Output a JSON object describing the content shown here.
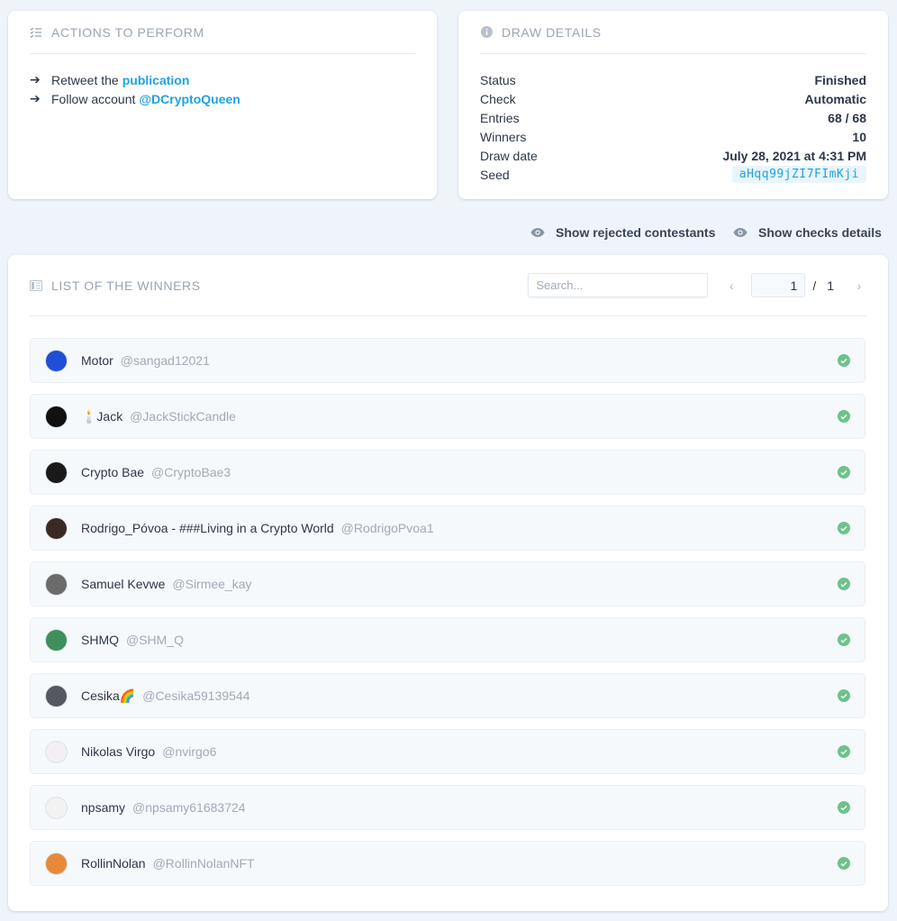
{
  "actions": {
    "title": "ACTIONS TO PERFORM",
    "items": [
      {
        "prefix": "Retweet the",
        "link": "publication"
      },
      {
        "prefix": "Follow account",
        "link": "@DCryptoQueen"
      }
    ]
  },
  "details": {
    "title": "DRAW DETAILS",
    "rows": [
      {
        "label": "Status",
        "value": "Finished"
      },
      {
        "label": "Check",
        "value": "Automatic"
      },
      {
        "label": "Entries",
        "value": "68 / 68"
      },
      {
        "label": "Winners",
        "value": "10"
      },
      {
        "label": "Draw date",
        "value": "July 28, 2021 at 4:31 PM"
      },
      {
        "label": "Seed",
        "value": "aHqq99jZI7FImKji"
      }
    ]
  },
  "toggles": {
    "rejected": "Show rejected contestants",
    "checks": "Show checks details"
  },
  "winners": {
    "title": "LIST OF THE WINNERS",
    "search_placeholder": "Search...",
    "page_current": "1",
    "page_separator": "/",
    "page_total": "1",
    "items": [
      {
        "name": "Motor",
        "handle": "@sangad12021",
        "avatar_color": "#1e4fd6"
      },
      {
        "name": "🕯️Jack",
        "handle": "@JackStickCandle",
        "avatar_color": "#111111"
      },
      {
        "name": "Crypto Bae",
        "handle": "@CryptoBae3",
        "avatar_color": "#1a1a1a"
      },
      {
        "name": "Rodrigo_Póvoa - ###Living in a Crypto World",
        "handle": "@RodrigoPvoa1",
        "avatar_color": "#3b2a22"
      },
      {
        "name": "Samuel Kevwe",
        "handle": "@Sirmee_kay",
        "avatar_color": "#6b6b6b"
      },
      {
        "name": "SHMQ",
        "handle": "@SHM_Q",
        "avatar_color": "#3f8f5a"
      },
      {
        "name": "Cesika🌈",
        "handle": "@Cesika59139544",
        "avatar_color": "#55585e"
      },
      {
        "name": "Nikolas Virgo",
        "handle": "@nvirgo6",
        "avatar_color": "#f3eef5"
      },
      {
        "name": "npsamy",
        "handle": "@npsamy61683724",
        "avatar_color": "#f2f2f2"
      },
      {
        "name": "RollinNolan",
        "handle": "@RollinNolanNFT",
        "avatar_color": "#e8893a"
      }
    ]
  },
  "colors": {
    "accent": "#1fa1e6",
    "check": "#6cc38a",
    "background": "#eef4fa"
  }
}
